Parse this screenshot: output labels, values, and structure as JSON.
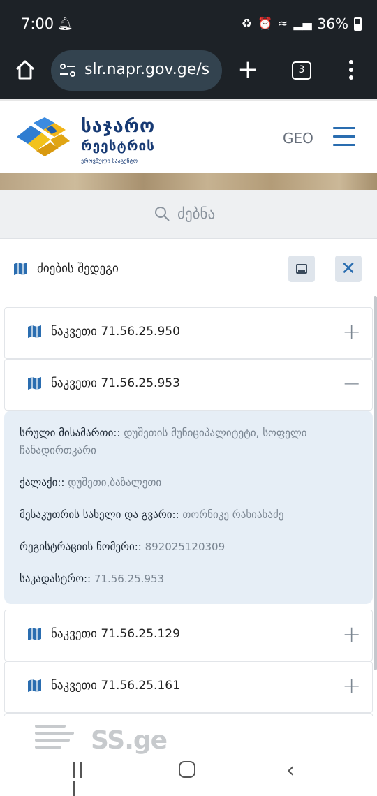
{
  "status_bar": {
    "time": "7:00",
    "battery_text": "36%"
  },
  "browser": {
    "url": "slr.napr.gov.ge/s",
    "tab_count": "3"
  },
  "site": {
    "brand_line1": "საჯარო",
    "brand_line2": "რეესტრის",
    "brand_line3": "ეროვნული სააგენტო",
    "language": "GEO"
  },
  "search": {
    "label": "ძებნა"
  },
  "results": {
    "title": "ძიების შედეგი",
    "items": [
      {
        "label": "ნაკვეთი 71.56.25.950",
        "toggle": "+"
      },
      {
        "label": "ნაკვეთი 71.56.25.953",
        "toggle": "−"
      },
      {
        "label": "ნაკვეთი 71.56.25.129",
        "toggle": "+"
      },
      {
        "label": "ნაკვეთი 71.56.25.161",
        "toggle": "+"
      }
    ],
    "details": {
      "address_key": "სრული მისამართი::",
      "address_value": "დუშეთის მუნიციპალიტეტი, სოფელი ჩანადირთკარი",
      "city_key": "ქალაქი::",
      "city_value": "დუშეთი,ბაზალეთი",
      "owner_key": "მესაკუთრის სახელი და გვარი::",
      "owner_value": "თორნიკე რახიახაძე",
      "reg_key": "რეგისტრაციის ნომერი::",
      "reg_value": "892025120309",
      "cadastre_key": "საკადასტრო::",
      "cadastre_value": "71.56.25.953"
    }
  },
  "watermark": {
    "text": "SS.ge"
  },
  "colors": {
    "accent": "#2a6db0",
    "brand": "#173a74",
    "details_bg": "#e6eef6"
  }
}
